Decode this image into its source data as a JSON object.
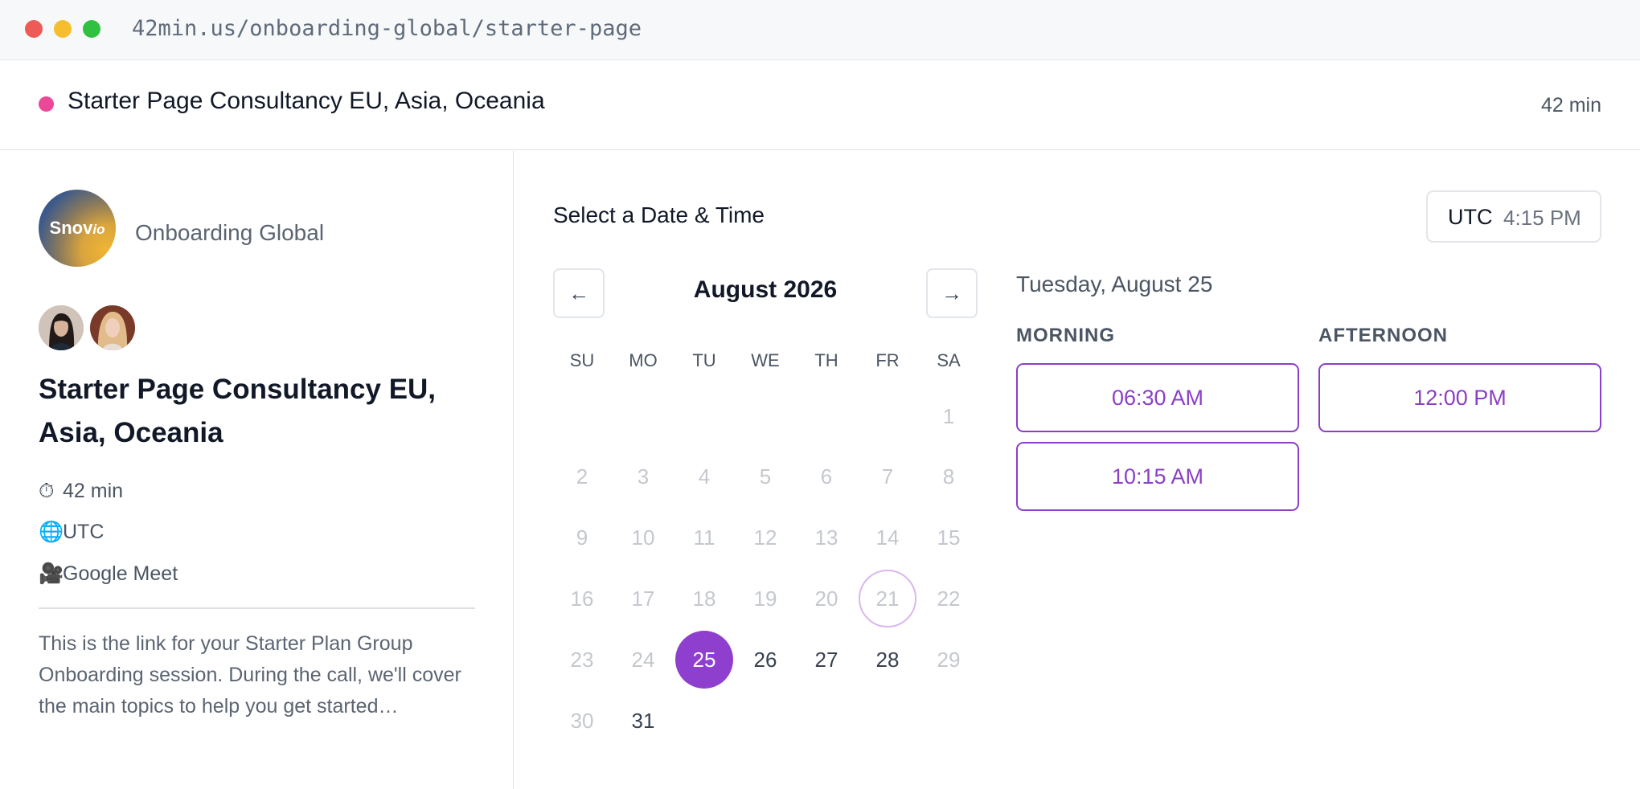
{
  "browser": {
    "url": "42min.us/onboarding-global/starter-page"
  },
  "header": {
    "event_title": "Starter Page Consultancy EU, Asia, Oceania",
    "duration": "42 min",
    "event_color": "#ec4899"
  },
  "left_panel": {
    "logo_text": "Snov",
    "logo_text_suffix": "io",
    "org_name": "Onboarding Global",
    "hosts": [
      "host-avatar-1",
      "host-avatar-2"
    ],
    "title": "Starter Page Consultancy EU, Asia, Oceania",
    "meta": {
      "duration_icon": "⏱",
      "duration": "42 min",
      "timezone_icon": "🌐",
      "timezone": "UTC",
      "location_icon": "🎥",
      "location": "Google Meet"
    },
    "description": "This is the link for your Starter Plan Group Onboarding session. During the call, we'll cover the main topics to help you get started…"
  },
  "scheduler": {
    "heading": "Select a Date & Time",
    "timezone_label": "UTC",
    "timezone_time": "4:15 PM",
    "prev_label": "←",
    "next_label": "→",
    "month_label": "August 2026",
    "weekdays": [
      "SU",
      "MO",
      "TU",
      "WE",
      "TH",
      "FR",
      "SA"
    ],
    "days": [
      "1",
      "2",
      "3",
      "4",
      "5",
      "6",
      "7",
      "8",
      "9",
      "10",
      "11",
      "12",
      "13",
      "14",
      "15",
      "16",
      "17",
      "18",
      "19",
      "20",
      "21",
      "22",
      "23",
      "24",
      "25",
      "26",
      "27",
      "28",
      "29",
      "30",
      "31"
    ],
    "available_days": [
      25,
      26,
      27,
      28,
      31
    ],
    "today_day": 21,
    "selected_day": 25,
    "selected_date_label": "Tuesday, August 25",
    "accent_color": "#8f3fcd",
    "morning_label": "MORNING",
    "afternoon_label": "AFTERNOON",
    "morning_slots": [
      "06:30 AM",
      "10:15 AM"
    ],
    "afternoon_slots": [
      "12:00 PM"
    ]
  }
}
